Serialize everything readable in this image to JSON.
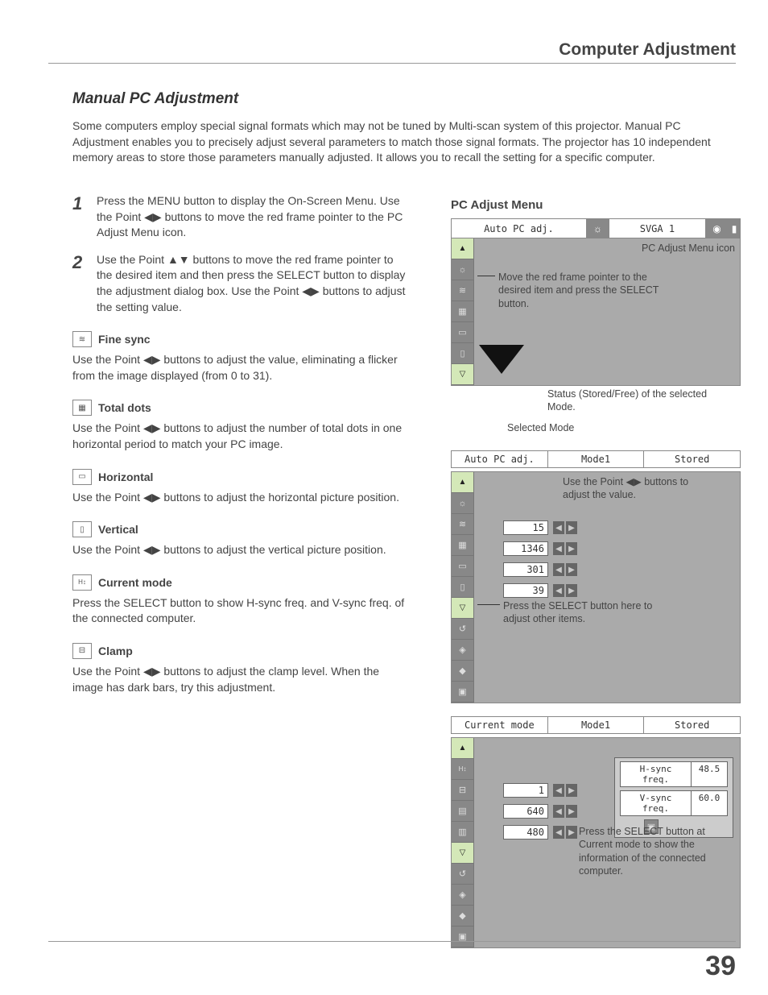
{
  "header": {
    "title": "Computer Adjustment"
  },
  "section": {
    "title": "Manual PC Adjustment"
  },
  "intro": "Some computers employ special signal formats which may not be tuned by Multi-scan system of this projector. Manual PC Adjustment enables you to precisely adjust several parameters to match those signal formats. The projector has 10 independent memory areas to store those parameters manually adjusted. It allows you to recall the setting for a specific computer.",
  "steps": [
    {
      "n": "1",
      "text_a": "Press the MENU button to display the On-Screen Menu. Use the Point ",
      "text_b": " buttons to move the red frame pointer to the PC Adjust Menu icon."
    },
    {
      "n": "2",
      "text_a": "Use the Point ",
      "text_mid": " buttons to move the red frame pointer to the desired item and then press the SELECT button to display the adjustment dialog box. Use the Point ",
      "text_b": " buttons to adjust the setting value."
    }
  ],
  "items": [
    {
      "title": "Fine sync",
      "body": "Use the Point ◀▶ buttons to adjust the value, eliminating a flicker from the image displayed (from 0 to 31)."
    },
    {
      "title": "Total dots",
      "body": "Use the Point ◀▶ buttons to adjust the number of total dots in one horizontal period to match your PC image."
    },
    {
      "title": "Horizontal",
      "body": "Use the Point ◀▶ buttons to adjust the horizontal picture position."
    },
    {
      "title": "Vertical",
      "body": "Use the Point ◀▶ buttons to adjust the vertical picture position."
    },
    {
      "title": "Current mode",
      "body": "Press the SELECT button to show H-sync freq. and V-sync freq. of the connected computer."
    },
    {
      "title": "Clamp",
      "body": "Use the Point ◀▶ buttons to adjust the clamp level. When the image has dark bars, try this adjustment."
    }
  ],
  "right": {
    "title": "PC Adjust Menu",
    "panel1": {
      "top_label": "Auto PC adj.",
      "svga": "SVGA 1",
      "anno_icon": "PC Adjust Menu icon",
      "anno_move": "Move the red frame pointer to the desired item and press the SELECT button.",
      "anno_status": "Status (Stored/Free) of the selected Mode.",
      "anno_selected": "Selected Mode",
      "status": {
        "a": "Auto PC adj.",
        "b": "Mode1",
        "c": "Stored"
      }
    },
    "panel2": {
      "anno_point": "Use the Point ◀▶ buttons to adjust the value.",
      "values": [
        "15",
        "1346",
        "301",
        "39"
      ],
      "anno_select": "Press the SELECT button here to adjust other items."
    },
    "panel3": {
      "status": {
        "a": "Current mode",
        "b": "Mode1",
        "c": "Stored"
      },
      "hsync_label": "H-sync freq.",
      "hsync_val": "48.5",
      "vsync_label": "V-sync freq.",
      "vsync_val": "60.0",
      "values": [
        "1",
        "640",
        "480"
      ],
      "anno": "Press the SELECT button at Current mode to show the information of the connected computer."
    }
  },
  "page": "39"
}
